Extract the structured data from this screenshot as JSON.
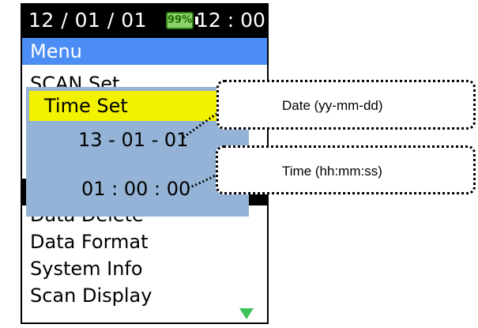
{
  "statusbar": {
    "date": "12 / 01 / 01",
    "battery": "99%",
    "time": "12 : 00",
    "battery_color": "#8bd36a"
  },
  "menu": {
    "title": "Menu",
    "accent_color": "#4c8df5",
    "items": [
      "SCAN Set",
      "Data Delete",
      "Data Format",
      "System Info",
      "Scan Display"
    ],
    "scroll_icon": "triangle-down-icon"
  },
  "popup": {
    "title": "Time Set",
    "date_value": "13 - 01 - 01",
    "time_value": "01 : 00 : 00",
    "title_color": "#f2f200",
    "background_color": "#94b3d6"
  },
  "callouts": {
    "date": "Date (yy-mm-dd)",
    "time": "Time (hh:mm:ss)"
  }
}
